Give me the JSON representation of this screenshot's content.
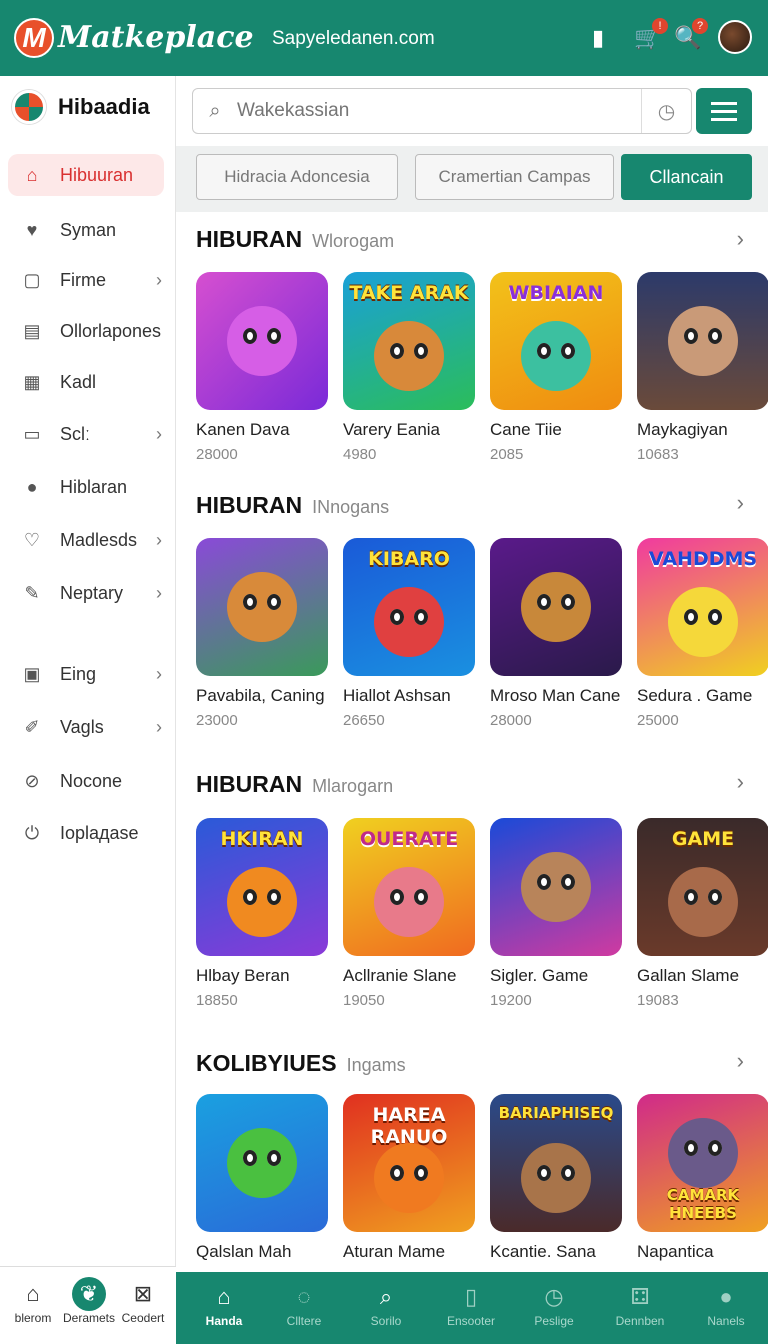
{
  "header": {
    "logo_letter": "M",
    "app_title": "Matkeplace",
    "site_url": "Sapyeledanen.com",
    "cart_badge": "!",
    "notif_badge": "?"
  },
  "sidebar": {
    "brand": "Hibaadia",
    "items": [
      {
        "label": "Hibuuran",
        "icon": "home-icon"
      },
      {
        "label": "Syman",
        "icon": "heart-icon"
      },
      {
        "label": "Firme",
        "icon": "calendar-icon"
      },
      {
        "label": "Ollorlapones",
        "icon": "card-icon"
      },
      {
        "label": "Kadl",
        "icon": "grid-icon"
      },
      {
        "label": "Sclː",
        "icon": "screen-icon"
      },
      {
        "label": "Hiblaran",
        "icon": "pin-icon"
      },
      {
        "label": "Madlesds",
        "icon": "tag-icon"
      },
      {
        "label": "Neptary",
        "icon": "pencil-icon"
      },
      {
        "label": "Eing",
        "icon": "box-icon"
      },
      {
        "label": "Vagls",
        "icon": "edit-icon"
      },
      {
        "label": "Nocone",
        "icon": "block-icon"
      },
      {
        "label": "Ioplадase",
        "icon": "power-icon"
      }
    ]
  },
  "search": {
    "placeholder": "Wakekassian"
  },
  "filters": {
    "chip1": "Hidracia Adoncesia",
    "chip2": "Cramertian Campas",
    "chip3": "Cllancain"
  },
  "sections": [
    {
      "title": "HIBURAN",
      "subtitle": "Wlorogam",
      "cards": [
        {
          "name": "Kanen Dava",
          "num": "28000",
          "banner": ""
        },
        {
          "name": "Varery Eania",
          "num": "4980",
          "banner": "TAKE ARAK"
        },
        {
          "name": "Cane Tiie",
          "num": "2085",
          "banner": "WBIAIAN"
        },
        {
          "name": "Maykagiyan",
          "num": "10683",
          "banner": ""
        }
      ]
    },
    {
      "title": "HIBURAN",
      "subtitle": "INnogans",
      "cards": [
        {
          "name": "Pavabila, Caning",
          "num": "23000",
          "banner": ""
        },
        {
          "name": "Hiallot Ashsan",
          "num": "26650",
          "banner": "KIBARO"
        },
        {
          "name": "Mroso Man Cane",
          "num": "28000",
          "banner": ""
        },
        {
          "name": "Sedura . Game",
          "num": "25000",
          "banner": "VAHDDMS"
        }
      ]
    },
    {
      "title": "HIBURAN",
      "subtitle": "Mlarogarn",
      "cards": [
        {
          "name": "Hlbay Beran",
          "num": "18850",
          "banner": "HKIRAN"
        },
        {
          "name": "Acllranie Slane",
          "num": "19050",
          "banner": "OUERATE"
        },
        {
          "name": "Sigler. Game",
          "num": "19200",
          "banner": ""
        },
        {
          "name": "Gallan Slame",
          "num": "19083",
          "banner": "GAME"
        }
      ]
    },
    {
      "title": "KOLIBYIUES",
      "subtitle": "Ingams",
      "cards": [
        {
          "name": "Qalslan Mah",
          "num": "",
          "banner": ""
        },
        {
          "name": "Aturan Mame",
          "num": "",
          "banner": "HAREA RANUO"
        },
        {
          "name": "Kcantie. Sana",
          "num": "",
          "banner": "BARIAPHISEQ"
        },
        {
          "name": "Napantica",
          "num": "",
          "banner": "CAMARK HNEEBS"
        }
      ]
    }
  ],
  "bottom_left": [
    {
      "label": "blerom",
      "icon": "home-outline-icon"
    },
    {
      "label": "Deramets",
      "icon": "leaf-icon"
    },
    {
      "label": "Ceodert",
      "icon": "frame-icon"
    }
  ],
  "bottom_right": [
    {
      "label": "Handa",
      "icon": "home-icon"
    },
    {
      "label": "Clltere",
      "icon": "globe-icon"
    },
    {
      "label": "Sorilo",
      "icon": "search-icon"
    },
    {
      "label": "Ensooter",
      "icon": "book-icon"
    },
    {
      "label": "Peslige",
      "icon": "clock-icon"
    },
    {
      "label": "Dennben",
      "icon": "dice-icon"
    },
    {
      "label": "Nanels",
      "icon": "person-icon"
    }
  ],
  "colors": {
    "brand": "#17876f",
    "accent": "#e8502b",
    "active_bg": "#fde8e8"
  }
}
